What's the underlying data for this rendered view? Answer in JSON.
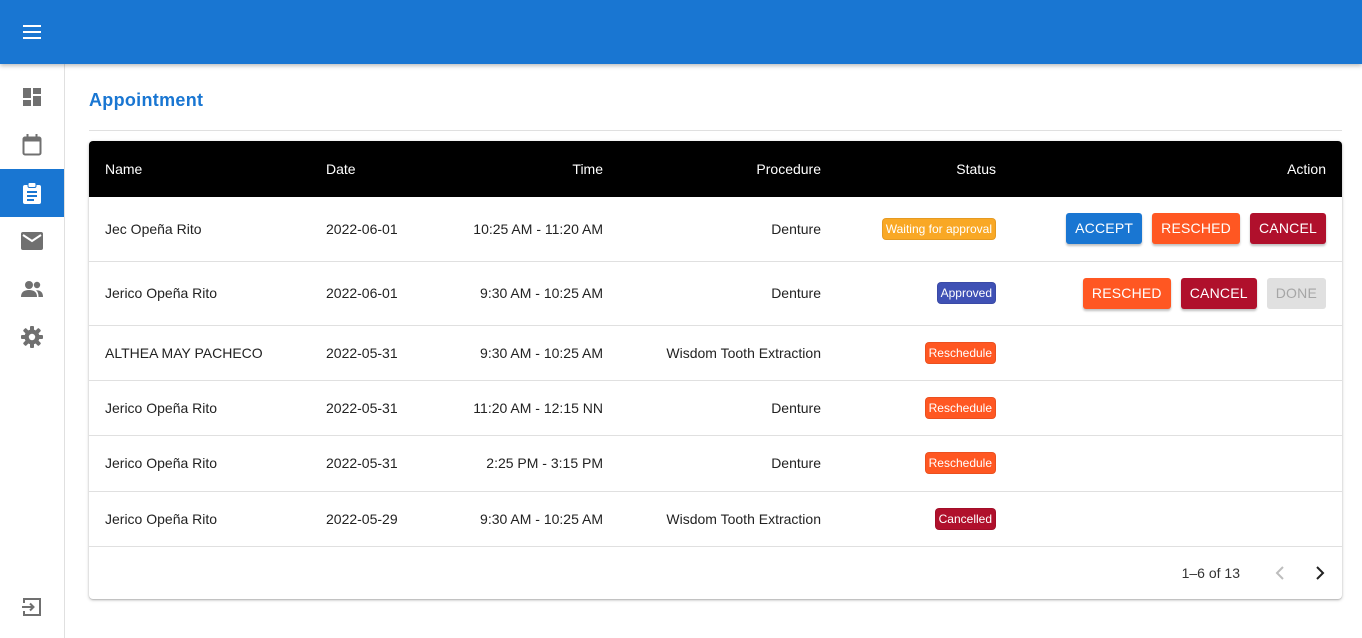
{
  "appbar": {
    "menu_icon": "menu-icon"
  },
  "sidebar": {
    "items": [
      {
        "name": "dashboard",
        "icon": "dashboard-icon",
        "active": false
      },
      {
        "name": "calendar",
        "icon": "calendar-icon",
        "active": false
      },
      {
        "name": "appointment",
        "icon": "clipboard-icon",
        "active": true
      },
      {
        "name": "mail",
        "icon": "mail-icon",
        "active": false
      },
      {
        "name": "users",
        "icon": "people-icon",
        "active": false
      },
      {
        "name": "settings",
        "icon": "gear-icon",
        "active": false
      }
    ],
    "logout_icon": "logout-icon"
  },
  "page": {
    "title": "Appointment"
  },
  "table": {
    "headers": {
      "name": "Name",
      "date": "Date",
      "time": "Time",
      "procedure": "Procedure",
      "status": "Status",
      "action": "Action"
    },
    "rows": [
      {
        "name": "Jec Opeña Rito",
        "date": "2022-06-01",
        "time": "10:25 AM - 11:20 AM",
        "procedure": "Denture",
        "status": "Waiting for approval",
        "status_color": "#f9a825",
        "actions": [
          {
            "label": "ACCEPT",
            "kind": "accept"
          },
          {
            "label": "RESCHED",
            "kind": "resched"
          },
          {
            "label": "CANCEL",
            "kind": "cancel"
          }
        ]
      },
      {
        "name": "Jerico Opeña Rito",
        "date": "2022-06-01",
        "time": "9:30 AM - 10:25 AM",
        "procedure": "Denture",
        "status": "Approved",
        "status_color": "#3f51b5",
        "actions": [
          {
            "label": "RESCHED",
            "kind": "resched"
          },
          {
            "label": "CANCEL",
            "kind": "cancel"
          },
          {
            "label": "DONE",
            "kind": "done"
          }
        ]
      },
      {
        "name": "ALTHEA MAY PACHECO",
        "date": "2022-05-31",
        "time": "9:30 AM - 10:25 AM",
        "procedure": "Wisdom Tooth Extraction",
        "status": "Reschedule",
        "status_color": "#ff5722",
        "actions": []
      },
      {
        "name": "Jerico Opeña Rito",
        "date": "2022-05-31",
        "time": "11:20 AM - 12:15 NN",
        "procedure": "Denture",
        "status": "Reschedule",
        "status_color": "#ff5722",
        "actions": []
      },
      {
        "name": "Jerico Opeña Rito",
        "date": "2022-05-31",
        "time": "2:25 PM - 3:15 PM",
        "procedure": "Denture",
        "status": "Reschedule",
        "status_color": "#ff5722",
        "actions": []
      },
      {
        "name": "Jerico Opeña Rito",
        "date": "2022-05-29",
        "time": "9:30 AM - 10:25 AM",
        "procedure": "Wisdom Tooth Extraction",
        "status": "Cancelled",
        "status_color": "#b0102c",
        "actions": []
      }
    ]
  },
  "pagination": {
    "range": "1–6 of 13",
    "prev_icon": "chevron-left-icon",
    "next_icon": "chevron-right-icon"
  },
  "colors": {
    "primary": "#1976d2",
    "header_bg": "#000000",
    "resched": "#ff5722",
    "cancel": "#b0102c"
  }
}
